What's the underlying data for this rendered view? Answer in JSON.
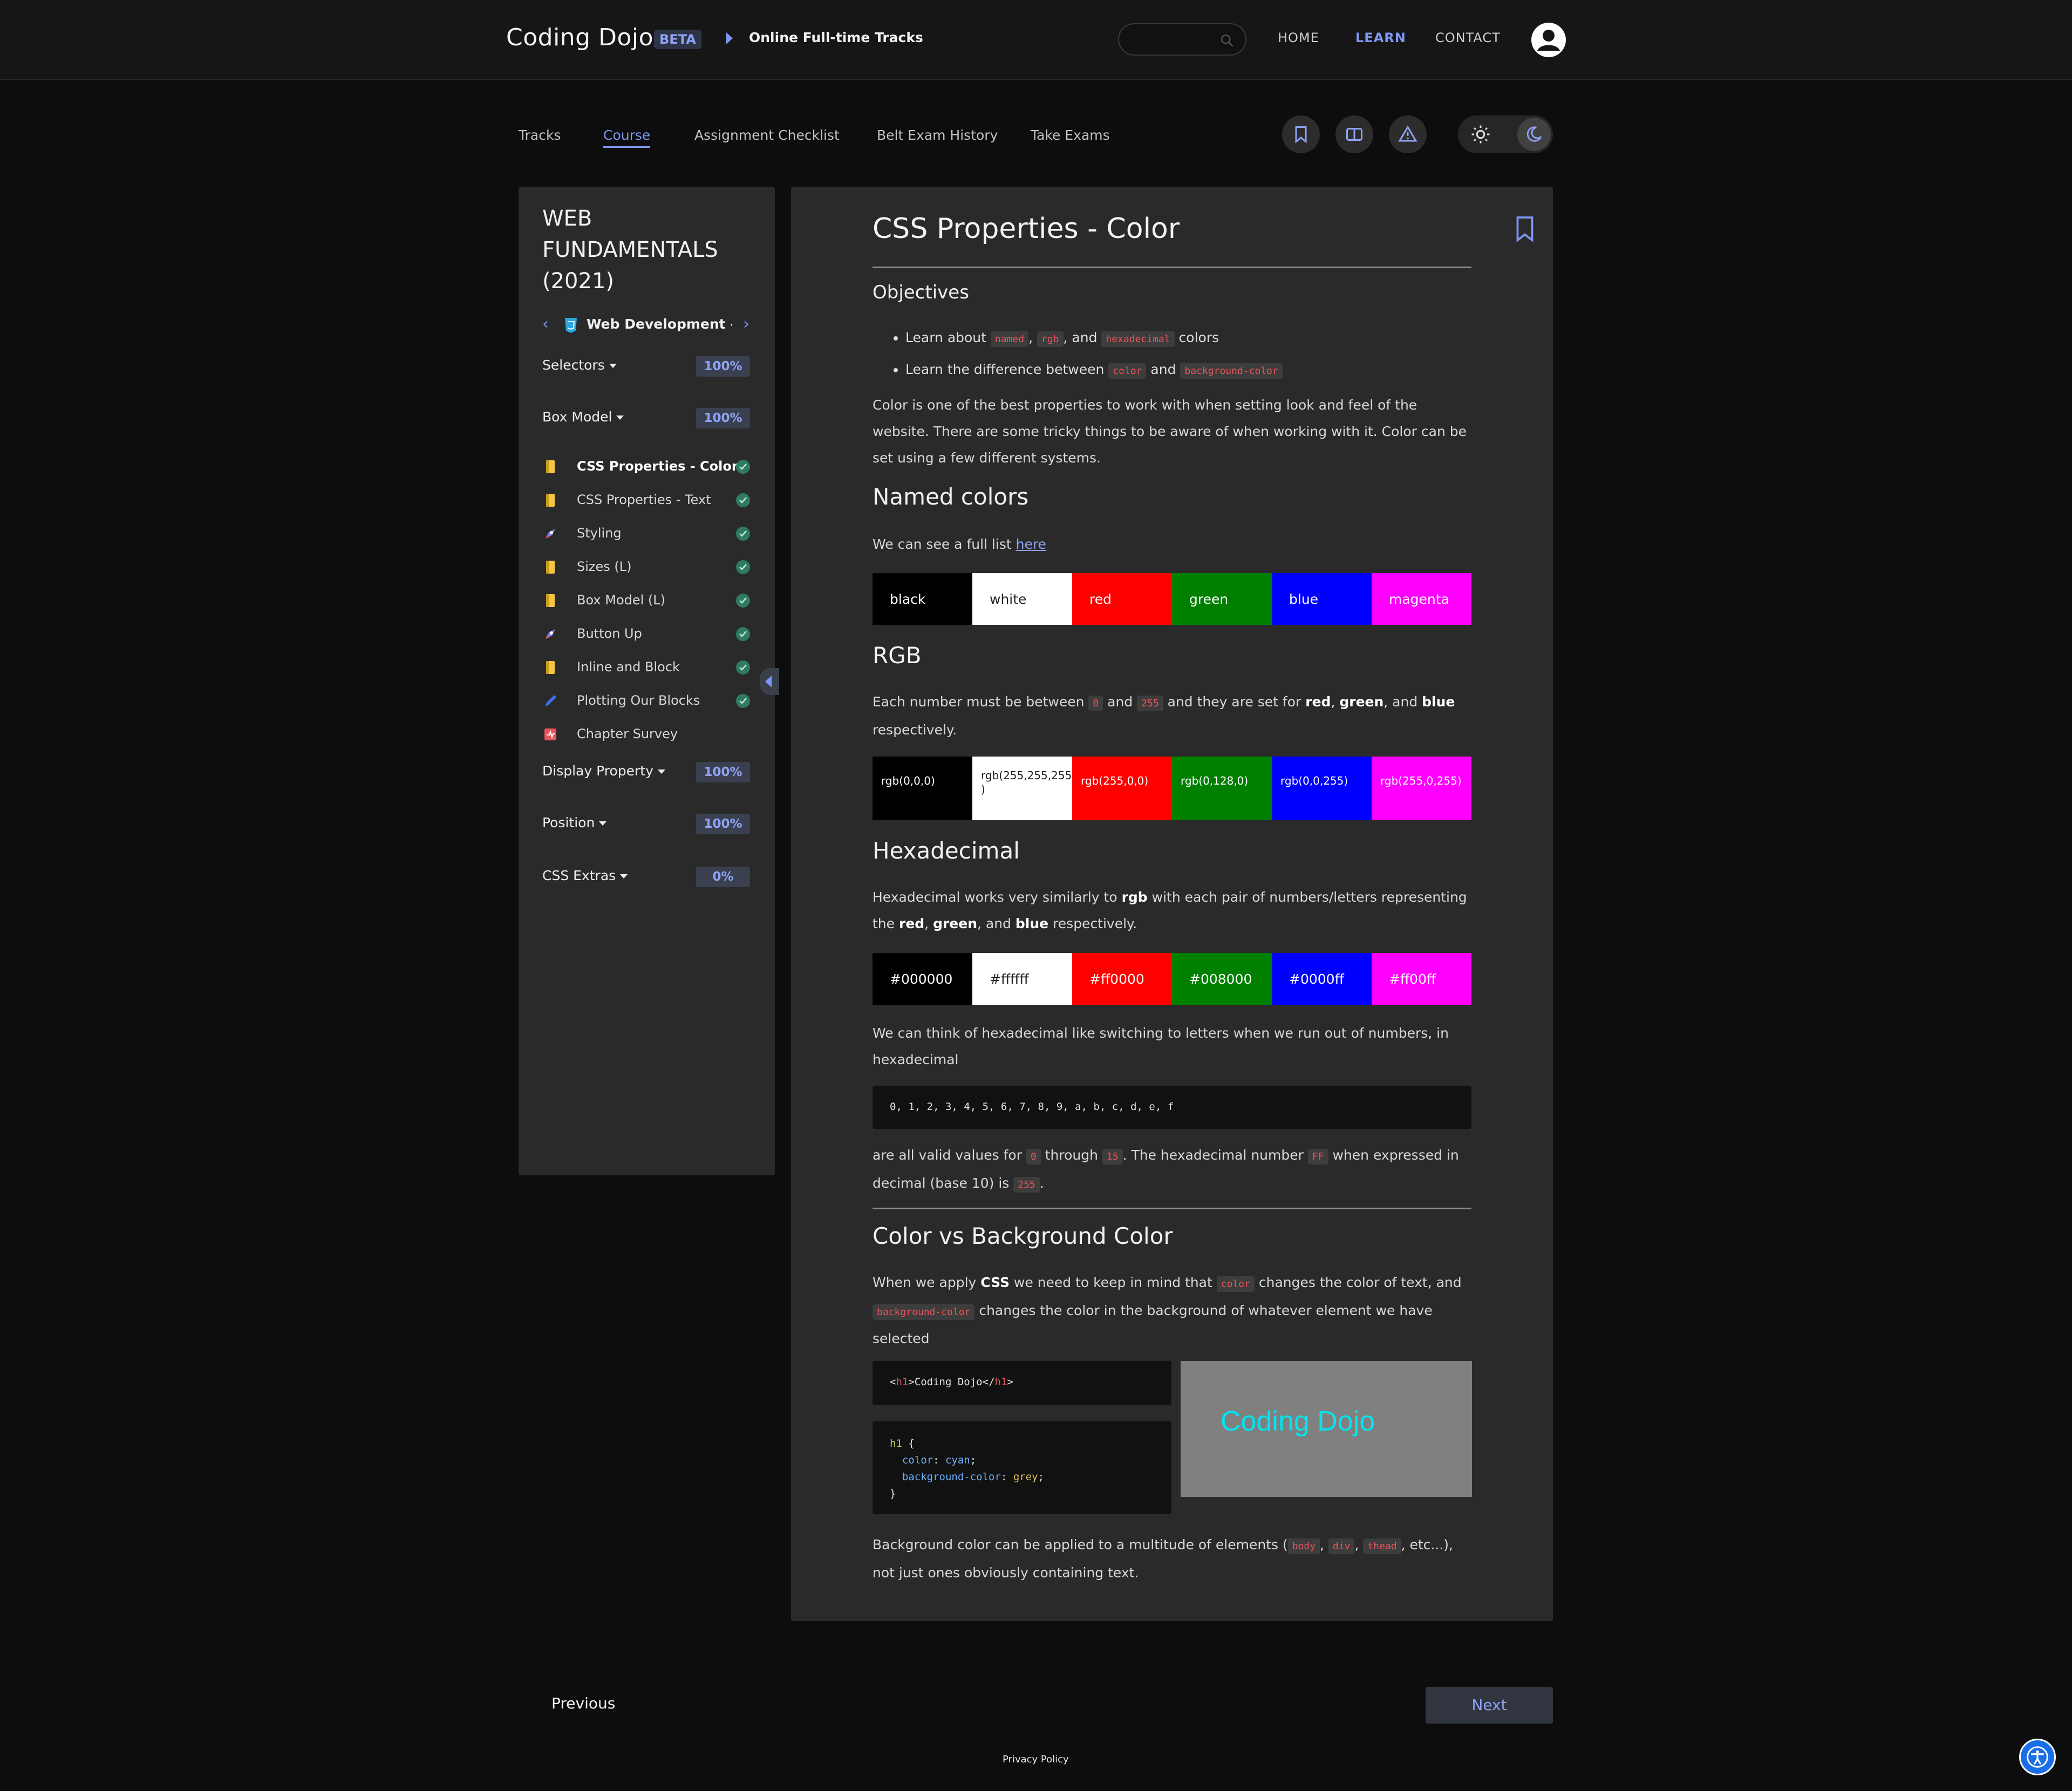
{
  "header": {
    "brand": "Coding Dojo",
    "beta": "BETA",
    "breadcrumb": "Online Full-time Tracks",
    "nav": [
      "HOME",
      "LEARN",
      "CONTACT"
    ],
    "active_nav": "LEARN"
  },
  "subnav": {
    "tabs": [
      "Tracks",
      "Course",
      "Assignment Checklist",
      "Belt Exam History",
      "Take Exams"
    ],
    "active_tab": "Course",
    "icons": [
      "bookmark-icon",
      "book-icon",
      "warning-icon"
    ]
  },
  "sidebar": {
    "title": "WEB FUNDAMENTALS (2021)",
    "chapter": "Web Development -...",
    "sections": [
      {
        "label": "Selectors",
        "pct": "100%"
      },
      {
        "label": "Box Model",
        "pct": "100%"
      },
      {
        "label": "Display Property",
        "pct": "100%"
      },
      {
        "label": "Position",
        "pct": "100%"
      },
      {
        "label": "CSS Extras",
        "pct": "0%"
      }
    ],
    "lessons": [
      {
        "label": "CSS Properties - Color",
        "icon": "document-icon",
        "done": true
      },
      {
        "label": "CSS Properties - Text",
        "icon": "document-icon",
        "done": true
      },
      {
        "label": "Styling",
        "icon": "rocket-icon",
        "done": true
      },
      {
        "label": "Sizes (L)",
        "icon": "document-icon",
        "done": true
      },
      {
        "label": "Box Model (L)",
        "icon": "document-icon",
        "done": true
      },
      {
        "label": "Button Up",
        "icon": "rocket-icon",
        "done": true
      },
      {
        "label": "Inline and Block",
        "icon": "document-icon",
        "done": true
      },
      {
        "label": "Plotting Our Blocks",
        "icon": "pencil-icon",
        "done": true
      },
      {
        "label": "Chapter Survey",
        "icon": "survey-icon",
        "done": false
      }
    ]
  },
  "article": {
    "title": "CSS Properties - Color",
    "objectives_heading": "Objectives",
    "obj1": {
      "a": "Learn about ",
      "c1": "named",
      "b": ", ",
      "c2": "rgb",
      "c": ", and ",
      "c3": "hexadecimal",
      "d": " colors"
    },
    "obj2": {
      "a": "Learn the difference between ",
      "c1": "color",
      "b": " and ",
      "c2": "background-color"
    },
    "intro": "Color is one of the best properties to work with when setting look and feel of the website. There are some tricky things to be aware of when working with it. Color can be set using a few different systems.",
    "named_heading": "Named colors",
    "named_text": "We can see a full list ",
    "named_link": "here",
    "named_swatches": [
      "black",
      "white",
      "red",
      "green",
      "blue",
      "magenta"
    ],
    "rgb_heading": "RGB",
    "rgb_text": {
      "a": "Each number must be between ",
      "c1": "0",
      "b": " and ",
      "c2": "255",
      "c": " and they are set for ",
      "r": "red",
      "comma": ", ",
      "g": "green",
      "and": ", and ",
      "bl": "blue",
      "d": " respectively."
    },
    "rgb_swatches": [
      "rgb(0,0,0)",
      "rgb(255,255,255\n)",
      "rgb(255,0,0)",
      "rgb(0,128,0)",
      "rgb(0,0,255)",
      "rgb(255,0,255)"
    ],
    "hex_heading": "Hexadecimal",
    "hex_text": {
      "a": "Hexadecimal works very similarly to ",
      "rgb": "rgb",
      "b": " with each pair of numbers/letters representing the ",
      "r": "red",
      "comma": ", ",
      "g": "green",
      "and": ", and ",
      "bl": "blue",
      "d": " respectively."
    },
    "hex_swatches": [
      "#000000",
      "#ffffff",
      "#ff0000",
      "#008000",
      "#0000ff",
      "#ff00ff"
    ],
    "hex_text2": "We can think of hexadecimal like switching to letters when we run out of numbers, in hexadecimal",
    "hex_code": "0, 1, 2, 3, 4, 5, 6, 7, 8, 9, a, b, c, d, e, f",
    "hex_text3": {
      "a": "are all valid values for ",
      "c1": "0",
      "b": " through ",
      "c2": "15",
      "c": ". The hexadecimal number ",
      "c3": "FF",
      "d": " when expressed in decimal (base 10) is ",
      "c4": "255",
      "e": "."
    },
    "cvb_heading": "Color vs Background Color",
    "cvb_text": {
      "a": "When we apply ",
      "css": "CSS",
      "b": " we need to keep in mind that ",
      "c1": "color",
      "c": " changes the color of text, and ",
      "c2": "background-color",
      "d": " changes the color in the background of whatever element we have selected"
    },
    "code1": {
      "open_lt": "<",
      "tag": "h1",
      "gt": ">",
      "text": "Coding Dojo",
      "close_lt": "</",
      "close_tag": "h1",
      "close_gt": ">"
    },
    "code2": {
      "sel": "h1",
      "open": " {",
      "p1": "color",
      "v1": "cyan",
      "p2": "background-color",
      "v2": "grey",
      "close": "}"
    },
    "demo_text": "Coding Dojo",
    "bg_text": {
      "a": "Background color can be applied to a multitude of elements (",
      "c1": "body",
      "s1": ", ",
      "c2": "div",
      "s2": ", ",
      "c3": "thead",
      "b": ", etc...), not just ones obviously containing text."
    }
  },
  "footer": {
    "previous": "Previous",
    "next": "Next",
    "privacy": "Privacy Policy"
  },
  "colors": {
    "accent": "#7f97f4",
    "swatches": [
      "#000000",
      "#ffffff",
      "#ff0000",
      "#008000",
      "#0000ff",
      "#ff00ff"
    ]
  }
}
